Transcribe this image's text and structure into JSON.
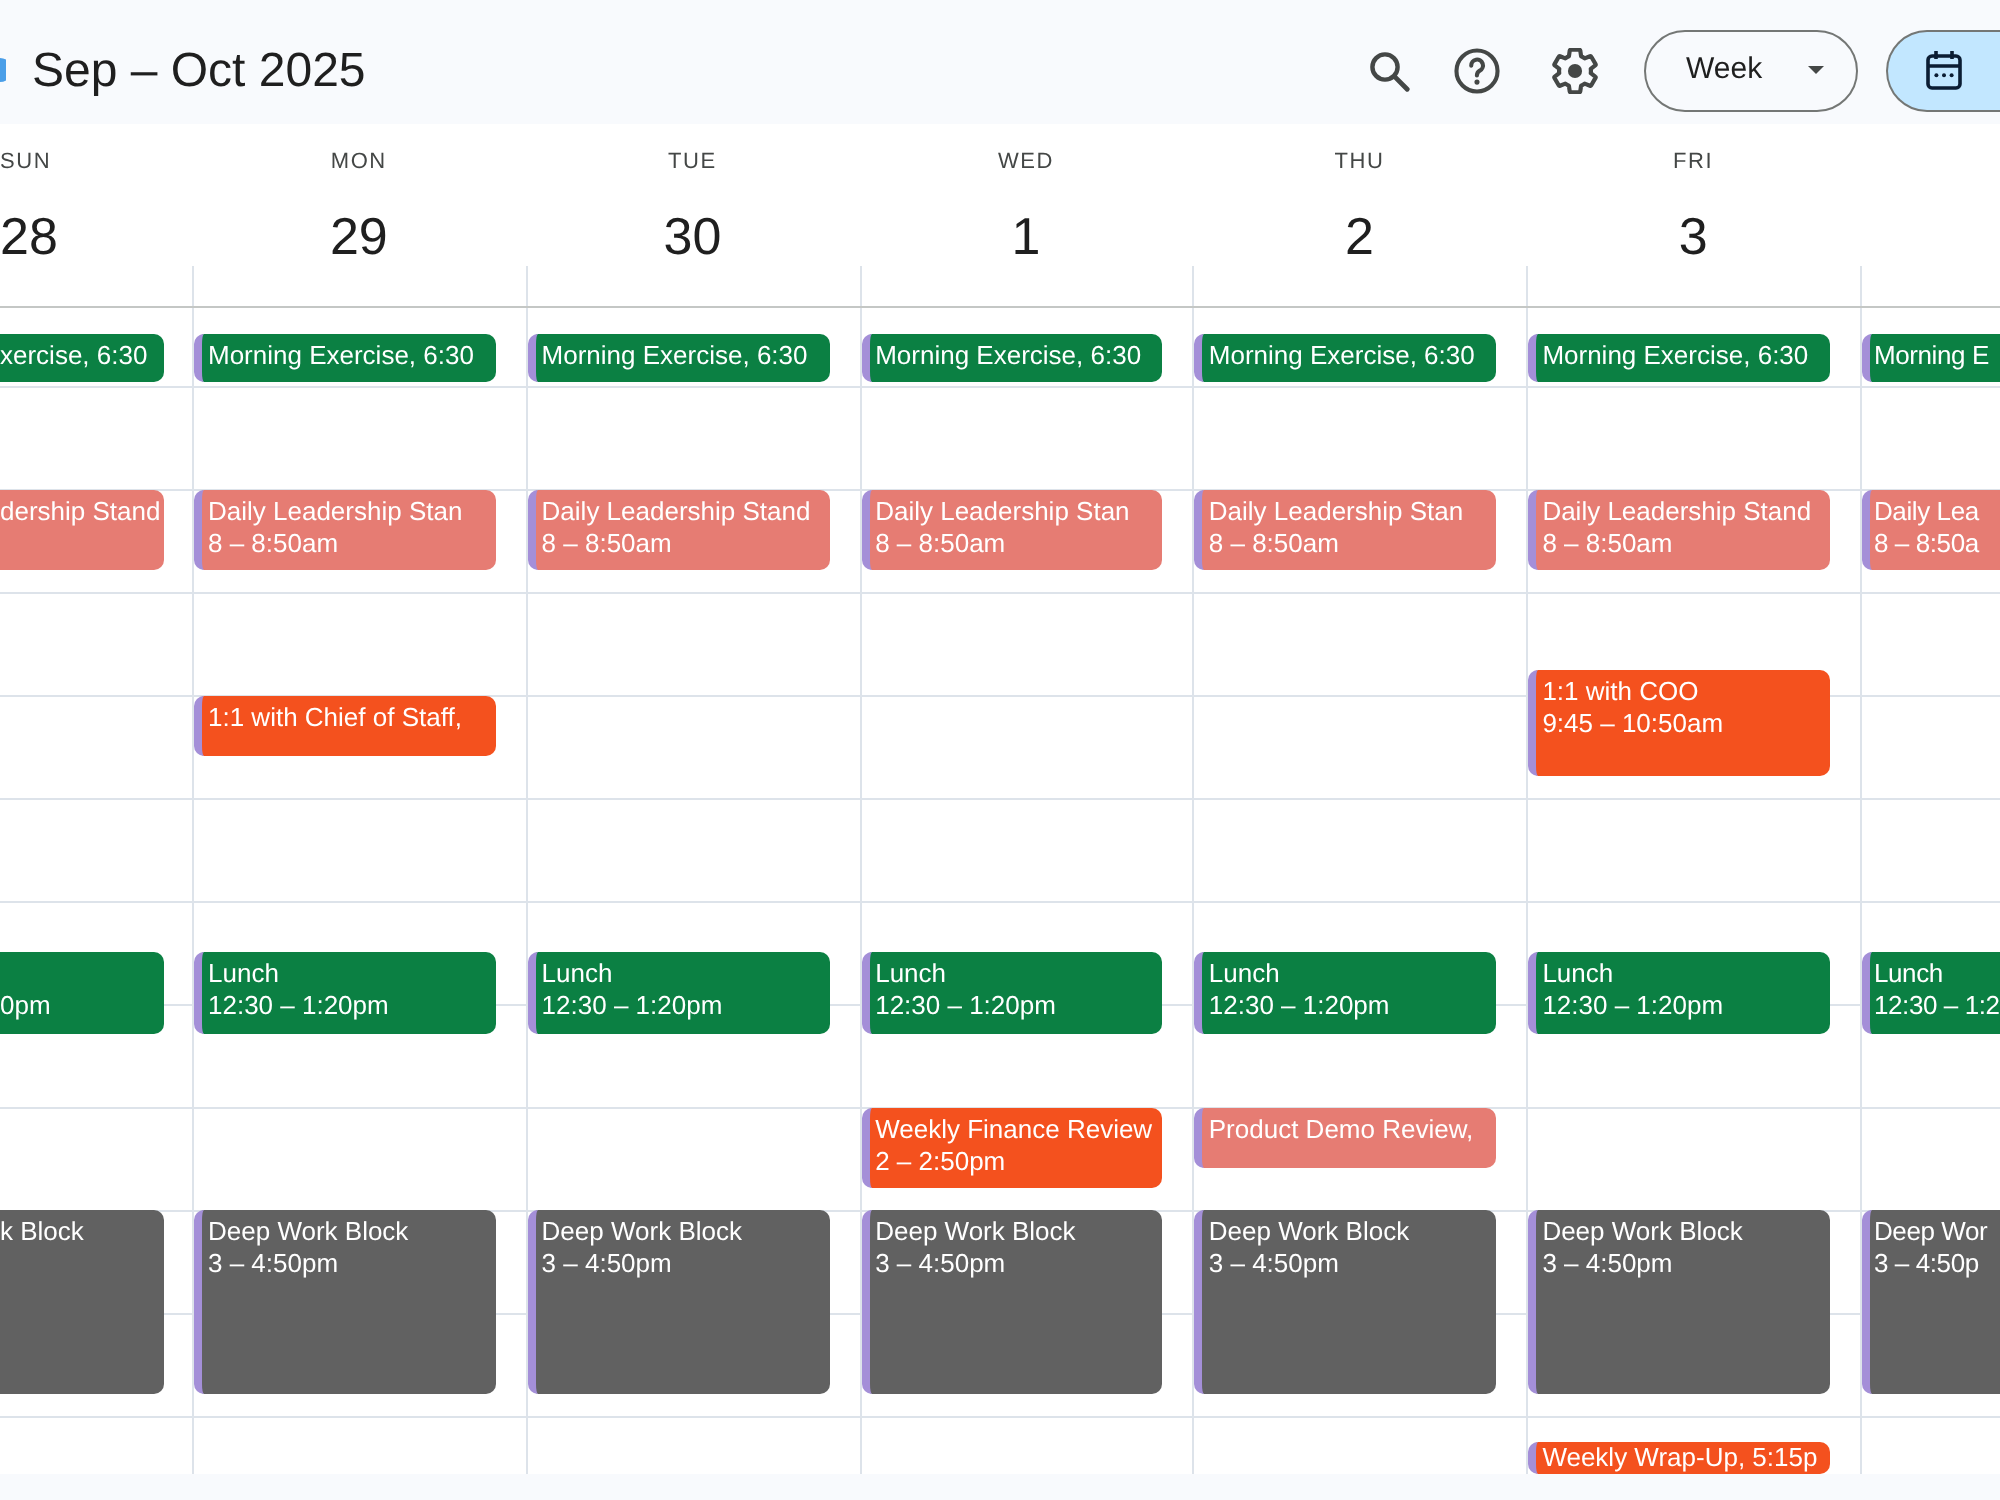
{
  "header": {
    "title": "Sep – Oct 2025",
    "view": "Week"
  },
  "days": [
    {
      "name": "SUN",
      "date": "28",
      "events": [
        {
          "title": "xercise, 6:30",
          "color": "#0b8043",
          "accent": false
        },
        {
          "title": "dership Stand",
          "color": "#e67c73",
          "accent": false
        },
        {
          "time": "0pm",
          "color": "#0b8043",
          "accent": false
        },
        {
          "title": "k Block",
          "color": "#616161",
          "accent": false
        }
      ]
    },
    {
      "name": "MON",
      "date": "29",
      "events": [
        {
          "title": "Morning Exercise, 6:30",
          "color": "#0b8043",
          "accent": true
        },
        {
          "title": "Daily Leadership Stan",
          "time": "8 – 8:50am",
          "color": "#e67c73",
          "accent": true
        },
        {
          "title": "1:1 with Chief of Staff,",
          "color": "#f4511e",
          "accent": true
        },
        {
          "title": "Lunch",
          "time": "12:30 – 1:20pm",
          "color": "#0b8043",
          "accent": true
        },
        {
          "title": "Deep Work Block",
          "time": "3 – 4:50pm",
          "color": "#616161",
          "accent": true
        }
      ]
    },
    {
      "name": "TUE",
      "date": "30",
      "events": [
        {
          "title": "Morning Exercise, 6:30",
          "color": "#0b8043",
          "accent": true
        },
        {
          "title": "Daily Leadership Stand",
          "time": "8 – 8:50am",
          "color": "#e67c73",
          "accent": true
        },
        {
          "title": "Lunch",
          "time": "12:30 – 1:20pm",
          "color": "#0b8043",
          "accent": true
        },
        {
          "title": "Deep Work Block",
          "time": "3 – 4:50pm",
          "color": "#616161",
          "accent": true
        }
      ]
    },
    {
      "name": "WED",
      "date": "1",
      "events": [
        {
          "title": "Morning Exercise, 6:30",
          "color": "#0b8043",
          "accent": true
        },
        {
          "title": "Daily Leadership Stan",
          "time": "8 – 8:50am",
          "color": "#e67c73",
          "accent": true
        },
        {
          "title": "Lunch",
          "time": "12:30 – 1:20pm",
          "color": "#0b8043",
          "accent": true
        },
        {
          "title": "Weekly Finance Review",
          "time": "2 – 2:50pm",
          "color": "#f4511e",
          "accent": true
        },
        {
          "title": "Deep Work Block",
          "time": "3 – 4:50pm",
          "color": "#616161",
          "accent": true
        }
      ]
    },
    {
      "name": "THU",
      "date": "2",
      "events": [
        {
          "title": "Morning Exercise, 6:30",
          "color": "#0b8043",
          "accent": true
        },
        {
          "title": "Daily Leadership Stan",
          "time": "8 – 8:50am",
          "color": "#e67c73",
          "accent": true
        },
        {
          "title": "Lunch",
          "time": "12:30 – 1:20pm",
          "color": "#0b8043",
          "accent": true
        },
        {
          "title": "Product Demo Review,",
          "color": "#e67c73",
          "accent": true
        },
        {
          "title": "Deep Work Block",
          "time": "3 – 4:50pm",
          "color": "#616161",
          "accent": true
        }
      ]
    },
    {
      "name": "FRI",
      "date": "3",
      "events": [
        {
          "title": "Morning Exercise, 6:30",
          "color": "#0b8043",
          "accent": true
        },
        {
          "title": "Daily Leadership Stand",
          "time": "8 – 8:50am",
          "color": "#e67c73",
          "accent": true
        },
        {
          "title": "1:1 with COO",
          "time": "9:45 – 10:50am",
          "color": "#f4511e",
          "accent": true
        },
        {
          "title": "Lunch",
          "time": "12:30 – 1:20pm",
          "color": "#0b8043",
          "accent": true
        },
        {
          "title": "Deep Work Block",
          "time": "3 – 4:50pm",
          "color": "#616161",
          "accent": true
        },
        {
          "title": "Weekly Wrap-Up, 5:15p",
          "color": "#f4511e",
          "accent": true
        }
      ]
    },
    {
      "events": [
        {
          "title": "Morning E",
          "color": "#0b8043",
          "accent": true
        },
        {
          "title": "Daily Lea",
          "time": "8 – 8:50a",
          "color": "#e67c73",
          "accent": true
        },
        {
          "title": "Lunch",
          "time": "12:30 – 1:2",
          "color": "#0b8043",
          "accent": true
        },
        {
          "title": "Deep Wor",
          "time": "3 – 4:50p",
          "color": "#616161",
          "accent": true
        }
      ]
    }
  ]
}
